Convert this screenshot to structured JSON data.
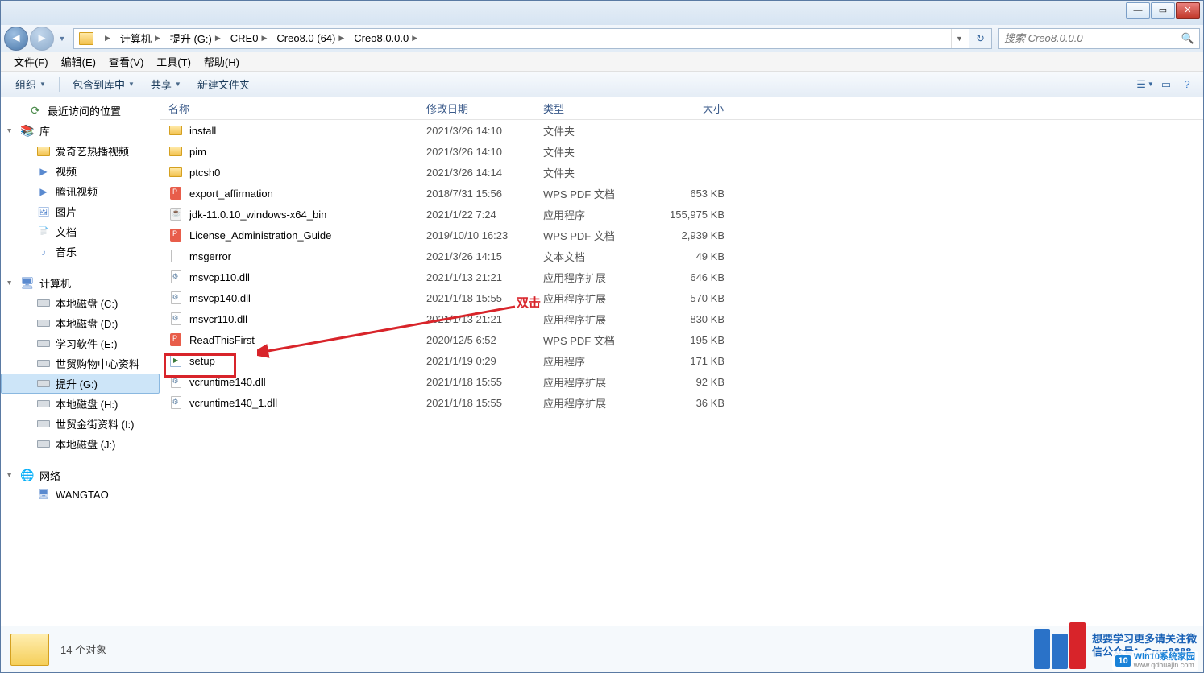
{
  "window_controls": {
    "min": "—",
    "max": "▭",
    "close": "✕"
  },
  "breadcrumb": [
    {
      "label": "计算机"
    },
    {
      "label": "提升 (G:)"
    },
    {
      "label": "CRE0"
    },
    {
      "label": "Creo8.0 (64)"
    },
    {
      "label": "Creo8.0.0.0"
    }
  ],
  "search": {
    "placeholder": "搜索 Creo8.0.0.0"
  },
  "menu": [
    {
      "label": "文件(F)"
    },
    {
      "label": "编辑(E)"
    },
    {
      "label": "查看(V)"
    },
    {
      "label": "工具(T)"
    },
    {
      "label": "帮助(H)"
    }
  ],
  "toolbar": {
    "organize": "组织",
    "include": "包含到库中",
    "share": "共享",
    "newfolder": "新建文件夹"
  },
  "nav": {
    "recent": "最近访问的位置",
    "libraries": "库",
    "lib_items": [
      "爱奇艺热播视频",
      "视频",
      "腾讯视频",
      "图片",
      "文档",
      "音乐"
    ],
    "computer": "计算机",
    "drives": [
      "本地磁盘 (C:)",
      "本地磁盘 (D:)",
      "学习软件 (E:)",
      "世贸购物中心资料",
      "提升 (G:)",
      "本地磁盘 (H:)",
      "世贸金街资料 (I:)",
      "本地磁盘 (J:)"
    ],
    "selected_drive_index": 4,
    "network": "网络",
    "net_items": [
      "WANGTAO"
    ]
  },
  "columns": {
    "name": "名称",
    "date": "修改日期",
    "type": "类型",
    "size": "大小"
  },
  "files": [
    {
      "icon": "folder",
      "name": "install",
      "date": "2021/3/26 14:10",
      "type": "文件夹",
      "size": ""
    },
    {
      "icon": "folder",
      "name": "pim",
      "date": "2021/3/26 14:10",
      "type": "文件夹",
      "size": ""
    },
    {
      "icon": "folder",
      "name": "ptcsh0",
      "date": "2021/3/26 14:14",
      "type": "文件夹",
      "size": ""
    },
    {
      "icon": "pdf",
      "name": "export_affirmation",
      "date": "2018/7/31 15:56",
      "type": "WPS PDF 文档",
      "size": "653 KB"
    },
    {
      "icon": "java",
      "name": "jdk-11.0.10_windows-x64_bin",
      "date": "2021/1/22 7:24",
      "type": "应用程序",
      "size": "155,975 KB"
    },
    {
      "icon": "pdf",
      "name": "License_Administration_Guide",
      "date": "2019/10/10 16:23",
      "type": "WPS PDF 文档",
      "size": "2,939 KB"
    },
    {
      "icon": "txt",
      "name": "msgerror",
      "date": "2021/3/26 14:15",
      "type": "文本文档",
      "size": "49 KB"
    },
    {
      "icon": "dll",
      "name": "msvcp110.dll",
      "date": "2021/1/13 21:21",
      "type": "应用程序扩展",
      "size": "646 KB"
    },
    {
      "icon": "dll",
      "name": "msvcp140.dll",
      "date": "2021/1/18 15:55",
      "type": "应用程序扩展",
      "size": "570 KB"
    },
    {
      "icon": "dll",
      "name": "msvcr110.dll",
      "date": "2021/1/13 21:21",
      "type": "应用程序扩展",
      "size": "830 KB"
    },
    {
      "icon": "pdf",
      "name": "ReadThisFirst",
      "date": "2020/12/5 6:52",
      "type": "WPS PDF 文档",
      "size": "195 KB"
    },
    {
      "icon": "exe",
      "name": "setup",
      "date": "2021/1/19 0:29",
      "type": "应用程序",
      "size": "171 KB"
    },
    {
      "icon": "dll",
      "name": "vcruntime140.dll",
      "date": "2021/1/18 15:55",
      "type": "应用程序扩展",
      "size": "92 KB"
    },
    {
      "icon": "dll",
      "name": "vcruntime140_1.dll",
      "date": "2021/1/18 15:55",
      "type": "应用程序扩展",
      "size": "36 KB"
    }
  ],
  "annotation": {
    "label": "双击",
    "box_row_index": 11
  },
  "status": {
    "count_text": "14 个对象"
  },
  "watermark": {
    "line1": "想要学习更多请关注微",
    "line2": "信公众号：Creo8888",
    "badge_text": "Win10系统家园",
    "badge_url": "www.qdhuajin.com"
  }
}
